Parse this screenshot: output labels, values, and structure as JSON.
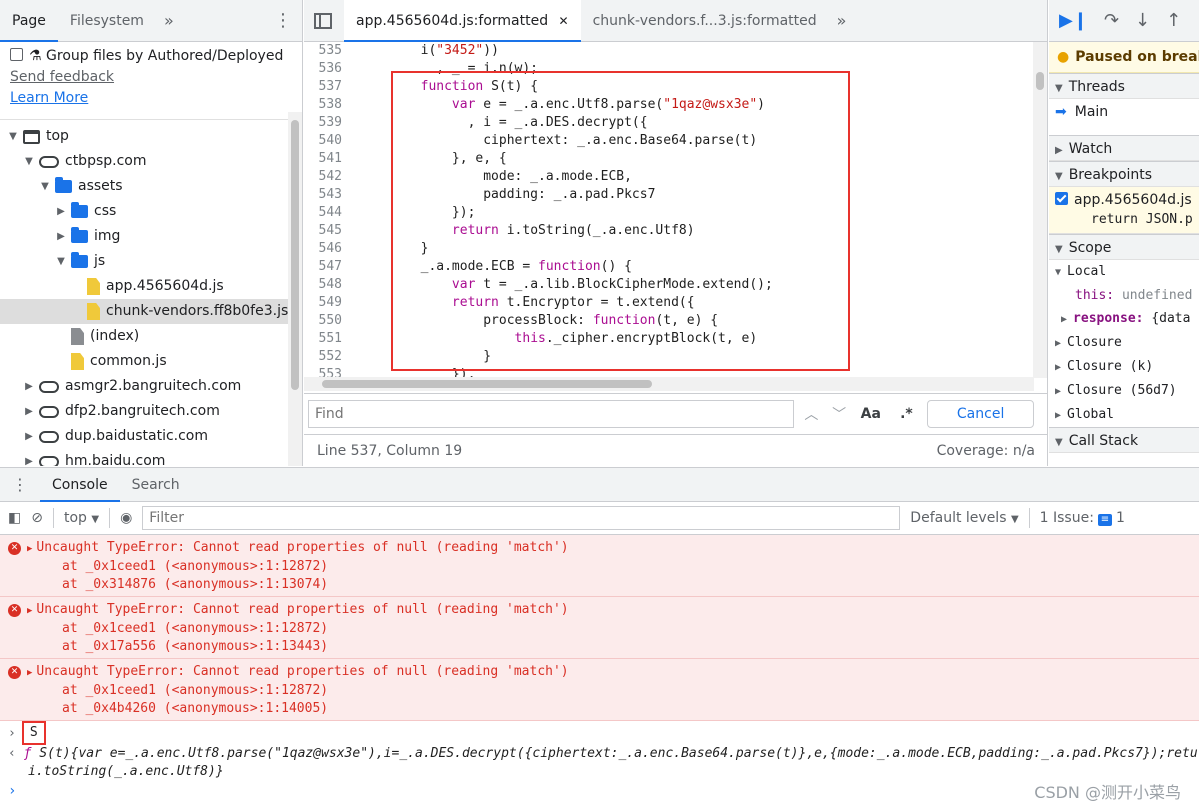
{
  "navigator": {
    "tabs": [
      "Page",
      "Filesystem"
    ],
    "more": "»",
    "group_label": "Group files by Authored/Deployed",
    "send_feedback": "Send feedback",
    "learn_more": "Learn More",
    "tree": [
      {
        "label": "top",
        "type": "frame",
        "indent": 0,
        "toggle": "▼"
      },
      {
        "label": "ctbpsp.com",
        "type": "cloud",
        "indent": 1,
        "toggle": "▼"
      },
      {
        "label": "assets",
        "type": "folder",
        "indent": 2,
        "toggle": "▼"
      },
      {
        "label": "css",
        "type": "folder",
        "indent": 3,
        "toggle": "▶"
      },
      {
        "label": "img",
        "type": "folder",
        "indent": 3,
        "toggle": "▶"
      },
      {
        "label": "js",
        "type": "folder",
        "indent": 3,
        "toggle": "▼"
      },
      {
        "label": "app.4565604d.js",
        "type": "file-y",
        "indent": 4,
        "toggle": ""
      },
      {
        "label": "chunk-vendors.ff8b0fe3.js",
        "type": "file-y",
        "indent": 4,
        "toggle": "",
        "selected": true
      },
      {
        "label": "(index)",
        "type": "file-g",
        "indent": 3,
        "toggle": ""
      },
      {
        "label": "common.js",
        "type": "file-y",
        "indent": 3,
        "toggle": ""
      },
      {
        "label": "asmgr2.bangruitech.com",
        "type": "cloud",
        "indent": 1,
        "toggle": "▶"
      },
      {
        "label": "dfp2.bangruitech.com",
        "type": "cloud",
        "indent": 1,
        "toggle": "▶"
      },
      {
        "label": "dup.baidustatic.com",
        "type": "cloud",
        "indent": 1,
        "toggle": "▶"
      },
      {
        "label": "hm.baidu.com",
        "type": "cloud",
        "indent": 1,
        "toggle": "▶"
      }
    ]
  },
  "editor": {
    "tabs": [
      {
        "label": "app.4565604d.js:formatted",
        "close": "✕"
      },
      {
        "label": "chunk-vendors.f...3.js:formatted"
      }
    ],
    "more": "»",
    "lines": [
      {
        "n": "535",
        "segs": [
          [
            "p",
            "        i("
          ],
          [
            "s",
            "\"3452\""
          ],
          [
            "p",
            "))"
          ]
        ]
      },
      {
        "n": "536",
        "segs": [
          [
            "p",
            "          , _ = i.n(w);"
          ]
        ]
      },
      {
        "n": "537",
        "segs": [
          [
            "p",
            "        "
          ],
          [
            "k",
            "function"
          ],
          [
            "p",
            " S(t) {"
          ]
        ]
      },
      {
        "n": "538",
        "segs": [
          [
            "p",
            "            "
          ],
          [
            "k",
            "var"
          ],
          [
            "p",
            " e = _.a.enc.Utf8.parse("
          ],
          [
            "s",
            "\"1qaz@wsx3e\""
          ],
          [
            "p",
            ")"
          ]
        ]
      },
      {
        "n": "539",
        "segs": [
          [
            "p",
            "              , i = _.a.DES.decrypt({"
          ]
        ]
      },
      {
        "n": "540",
        "segs": [
          [
            "p",
            "                ciphertext: _.a.enc.Base64.parse(t)"
          ]
        ]
      },
      {
        "n": "541",
        "segs": [
          [
            "p",
            "            }, e, {"
          ]
        ]
      },
      {
        "n": "542",
        "segs": [
          [
            "p",
            "                mode: _.a.mode.ECB,"
          ]
        ]
      },
      {
        "n": "543",
        "segs": [
          [
            "p",
            "                padding: _.a.pad.Pkcs7"
          ]
        ]
      },
      {
        "n": "544",
        "segs": [
          [
            "p",
            "            });"
          ]
        ]
      },
      {
        "n": "545",
        "segs": [
          [
            "p",
            "            "
          ],
          [
            "k",
            "return"
          ],
          [
            "p",
            " i.toString(_.a.enc.Utf8)"
          ]
        ]
      },
      {
        "n": "546",
        "segs": [
          [
            "p",
            "        }"
          ]
        ]
      },
      {
        "n": "547",
        "segs": [
          [
            "p",
            "        _.a.mode.ECB = "
          ],
          [
            "k",
            "function"
          ],
          [
            "p",
            "() {"
          ]
        ]
      },
      {
        "n": "548",
        "segs": [
          [
            "p",
            "            "
          ],
          [
            "k",
            "var"
          ],
          [
            "p",
            " t = _.a.lib.BlockCipherMode.extend();"
          ]
        ]
      },
      {
        "n": "549",
        "segs": [
          [
            "p",
            "            "
          ],
          [
            "k",
            "return"
          ],
          [
            "p",
            " t.Encryptor = t.extend({"
          ]
        ]
      },
      {
        "n": "550",
        "segs": [
          [
            "p",
            "                processBlock: "
          ],
          [
            "k",
            "function"
          ],
          [
            "p",
            "(t, e) {"
          ]
        ]
      },
      {
        "n": "551",
        "segs": [
          [
            "p",
            "                    "
          ],
          [
            "k",
            "this"
          ],
          [
            "p",
            "._cipher.encryptBlock(t, e)"
          ]
        ]
      },
      {
        "n": "552",
        "segs": [
          [
            "p",
            "                }"
          ]
        ]
      },
      {
        "n": "553",
        "segs": [
          [
            "p",
            "            }),"
          ]
        ]
      }
    ],
    "find_placeholder": "Find",
    "aa": "Aa",
    "regex": ".*",
    "cancel": "Cancel",
    "status_left": "Line 537, Column 19",
    "status_right": "Coverage: n/a"
  },
  "debugger": {
    "paused": "Paused on breakpoint",
    "threads": "Threads",
    "main": "Main",
    "watch": "Watch",
    "breakpoints": "Breakpoints",
    "bp_file": "app.4565604d.js",
    "bp_code": "return JSON.p",
    "scope": "Scope",
    "local": "Local",
    "this_key": "this:",
    "this_val": "undefined",
    "response_key": "response:",
    "response_val": "{data",
    "closures": [
      "Closure",
      "Closure (k)",
      "Closure (56d7)",
      "Global"
    ],
    "call_stack": "Call Stack"
  },
  "console": {
    "tabs": [
      "Console",
      "Search"
    ],
    "context": "top",
    "filter_placeholder": "Filter",
    "levels": "Default levels",
    "issues_label": "1 Issue:",
    "issues_count": "1",
    "errors": [
      {
        "msg": "Uncaught TypeError: Cannot read properties of null (reading 'match')",
        "stack": [
          "at _0x1ceed1 (<anonymous>:1:12872)",
          "at _0x314876 (<anonymous>:1:13074)"
        ]
      },
      {
        "msg": "Uncaught TypeError: Cannot read properties of null (reading 'match')",
        "stack": [
          "at _0x1ceed1 (<anonymous>:1:12872)",
          "at _0x17a556 (<anonymous>:1:13443)"
        ]
      },
      {
        "msg": "Uncaught TypeError: Cannot read properties of null (reading 'match')",
        "stack": [
          "at _0x1ceed1 (<anonymous>:1:12872)",
          "at _0x4b4260 (<anonymous>:1:14005)"
        ]
      }
    ],
    "input": "S",
    "output_f": "ƒ",
    "output_line1": " S(t){var e=_.a.enc.Utf8.parse(\"1qaz@wsx3e\"),i=_.a.DES.decrypt({ciphertext:_.a.enc.Base64.parse(t)},e,{mode:_.a.mode.ECB,padding:_.a.pad.Pkcs7});return",
    "output_line2": "i.toString(_.a.enc.Utf8)}"
  },
  "watermark": "CSDN @测开小菜鸟",
  "colors": {
    "accent": "#1a73e8",
    "error_bg": "#fcebeb",
    "highlight_box": "#e8322d"
  }
}
